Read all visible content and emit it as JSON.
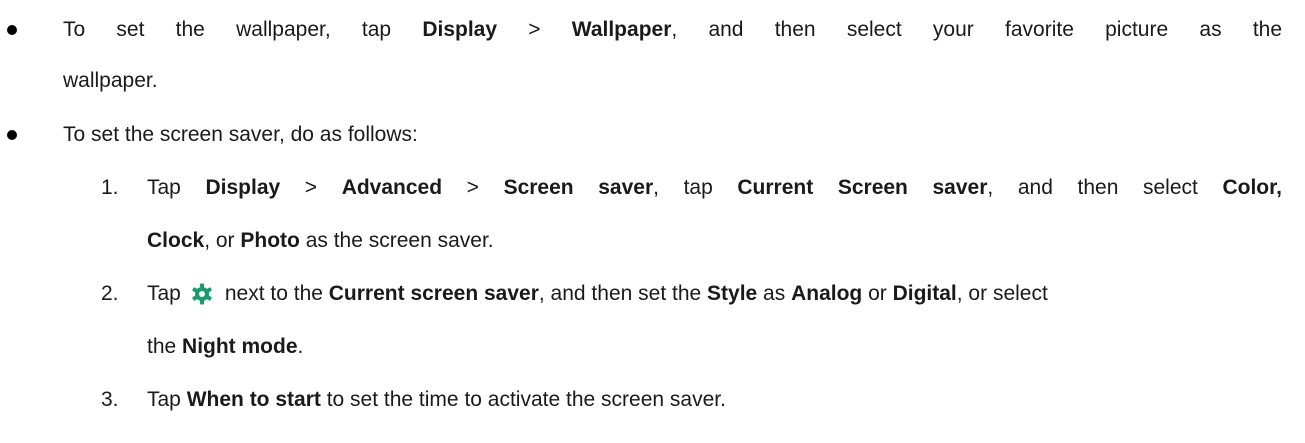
{
  "bullet1": {
    "line1": {
      "t1": "To set the wallpaper, tap ",
      "t2": "Display",
      "t3": " > ",
      "t4": "Wallpaper",
      "t5": ", and then select your favorite picture as the"
    },
    "line2": "wallpaper."
  },
  "bullet2": {
    "text": "To set the screen saver, do as follows:"
  },
  "steps": [
    {
      "num": "1.",
      "line1": {
        "t1": "Tap ",
        "t2": "Display",
        "t3": " > ",
        "t4": "Advanced",
        "t5": " > ",
        "t6": "Screen saver",
        "t7": ", tap ",
        "t8": "Current Screen saver",
        "t9": ", and then select ",
        "t10": "Color,"
      },
      "line2": {
        "t1": "Clock",
        "t2": ", or ",
        "t3": "Photo",
        "t4": " as the screen saver."
      }
    },
    {
      "num": "2.",
      "line1": {
        "t1": "Tap",
        "t2": "next to the ",
        "t3": "Current screen saver",
        "t4": ", and then set the ",
        "t5": "Style",
        "t6": " as ",
        "t7": "Analog",
        "t8": " or ",
        "t9": "Digital",
        "t10": ", or select"
      },
      "line2": {
        "t1": "the ",
        "t2": "Night mode",
        "t3": "."
      }
    },
    {
      "num": "3.",
      "line1": {
        "t1": "Tap ",
        "t2": "When to start",
        "t3": " to set the time to activate the screen saver."
      }
    }
  ],
  "icons": {
    "settings_icon": "gear-icon",
    "settings_icon_color": "#1e9b6e"
  }
}
